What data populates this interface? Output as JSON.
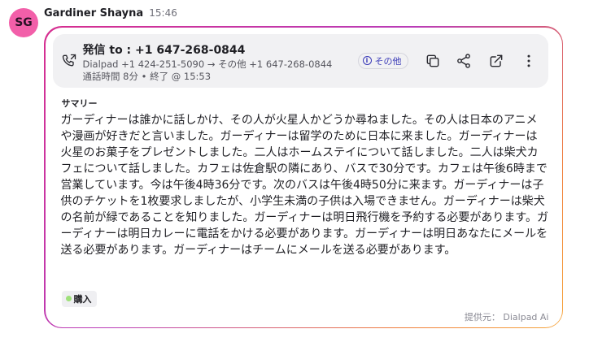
{
  "message": {
    "avatar_initials": "SG",
    "sender_name": "Gardiner Shayna",
    "time": "15:46"
  },
  "call": {
    "title": "発信 to : +1 647-268-0844",
    "route": "Dialpad +1 424-251-5090 → その他 +1 647-268-0844",
    "meta": "通話時間 8分 • 終了 @ 15:53",
    "other_label": "その他",
    "icons": [
      "outgoing-call-icon",
      "info-icon",
      "copy-icon",
      "share-icon",
      "external-link-icon",
      "more-vertical-icon"
    ]
  },
  "summary": {
    "label": "サマリー",
    "text": "ガーディナーは誰かに話しかけ、その人が火星人かどうか尋ねました。その人は日本のアニメや漫画が好きだと言いました。ガーディナーは留学のために日本に来ました。ガーディナーは火星のお菓子をプレゼントしました。二人はホームステイについて話しました。二人は柴犬カフェについて話しました。カフェは佐倉駅の隣にあり、バスで30分です。カフェは午後6時まで営業しています。今は午後4時36分です。次のバスは午後4時50分に来ます。ガーディナーは子供のチケットを1枚要求しましたが、小学生未満の子供は入場できません。ガーディナーは柴犬の名前が緑であることを知りました。ガーディナーは明日飛行機を予約する必要があります。ガーディナーは明日カレーに電話をかける必要があります。ガーディナーは明日あなたにメールを送る必要があります。ガーディナーはチームにメールを送る必要があります。"
  },
  "tag": {
    "label": "購入",
    "color": "#9ee07a"
  },
  "footer": {
    "provider": "提供元： Dialpad Ai"
  },
  "colors": {
    "avatar": "#f25fa9",
    "accent": "#3b3bb8",
    "border_gradient": [
      "#d62e8f",
      "#b93cb8",
      "#f07d3a",
      "#f6a53a"
    ]
  }
}
